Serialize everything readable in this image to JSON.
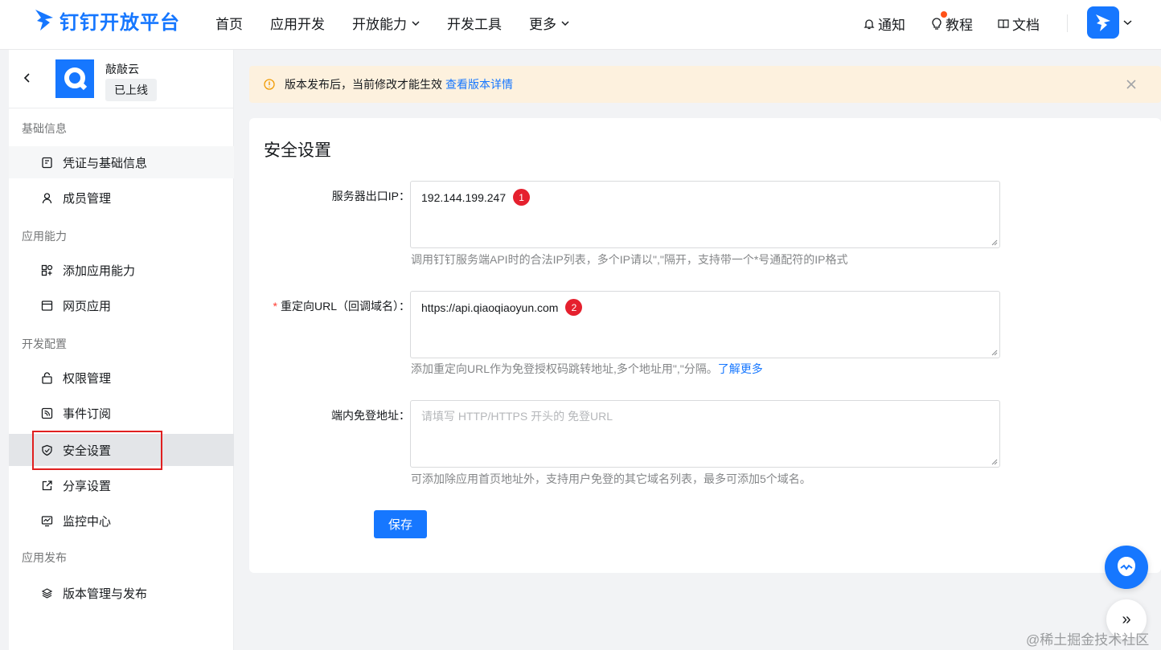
{
  "brand": {
    "name": "钉钉开放平台",
    "accent": "#1677ff"
  },
  "nav": {
    "items": [
      {
        "label": "首页",
        "dropdown": false
      },
      {
        "label": "应用开发",
        "dropdown": false
      },
      {
        "label": "开放能力",
        "dropdown": true
      },
      {
        "label": "开发工具",
        "dropdown": false
      },
      {
        "label": "更多",
        "dropdown": true
      }
    ]
  },
  "topright": {
    "notify": "通知",
    "tutorial": "教程",
    "docs": "文档"
  },
  "app": {
    "name": "敲敲云",
    "status": "已上线"
  },
  "sidebar": {
    "groups": [
      {
        "title": "基础信息"
      },
      {
        "title": "应用能力"
      },
      {
        "title": "开发配置"
      },
      {
        "title": "应用发布"
      }
    ],
    "items": [
      {
        "label": "凭证与基础信息",
        "icon": "credential-icon"
      },
      {
        "label": "成员管理",
        "icon": "member-icon"
      },
      {
        "label": "添加应用能力",
        "icon": "apps-icon"
      },
      {
        "label": "网页应用",
        "icon": "webpage-icon"
      },
      {
        "label": "权限管理",
        "icon": "permission-icon"
      },
      {
        "label": "事件订阅",
        "icon": "rss-icon"
      },
      {
        "label": "安全设置",
        "icon": "shield-icon"
      },
      {
        "label": "分享设置",
        "icon": "share-icon"
      },
      {
        "label": "监控中心",
        "icon": "monitor-icon"
      },
      {
        "label": "版本管理与发布",
        "icon": "layers-icon"
      }
    ],
    "active_item": "安全设置"
  },
  "notice": {
    "text": "版本发布后，当前修改才能生效",
    "link": "查看版本详情"
  },
  "form": {
    "title": "安全设置",
    "fields": [
      {
        "label": "服务器出口IP：",
        "required": false,
        "value": "192.144.199.247",
        "badge": "1",
        "help": "调用钉钉服务端API时的合法IP列表，多个IP请以\",\"隔开，支持带一个*号通配符的IP格式"
      },
      {
        "label": "重定向URL（回调域名）：",
        "required": true,
        "value": "https://api.qiaoqiaoyun.com",
        "badge": "2",
        "help": "添加重定向URL作为免登授权码跳转地址,多个地址用\",\"分隔。",
        "help_link": "了解更多"
      },
      {
        "label": "端内免登地址：",
        "required": false,
        "placeholder": "请填写 HTTP/HTTPS 开头的 免登URL",
        "help": "可添加除应用首页地址外，支持用户免登的其它域名列表，最多可添加5个域名。"
      }
    ],
    "save_label": "保存"
  },
  "watermark": "@稀土掘金技术社区",
  "expand_glyph": "»",
  "required_mark": "*"
}
